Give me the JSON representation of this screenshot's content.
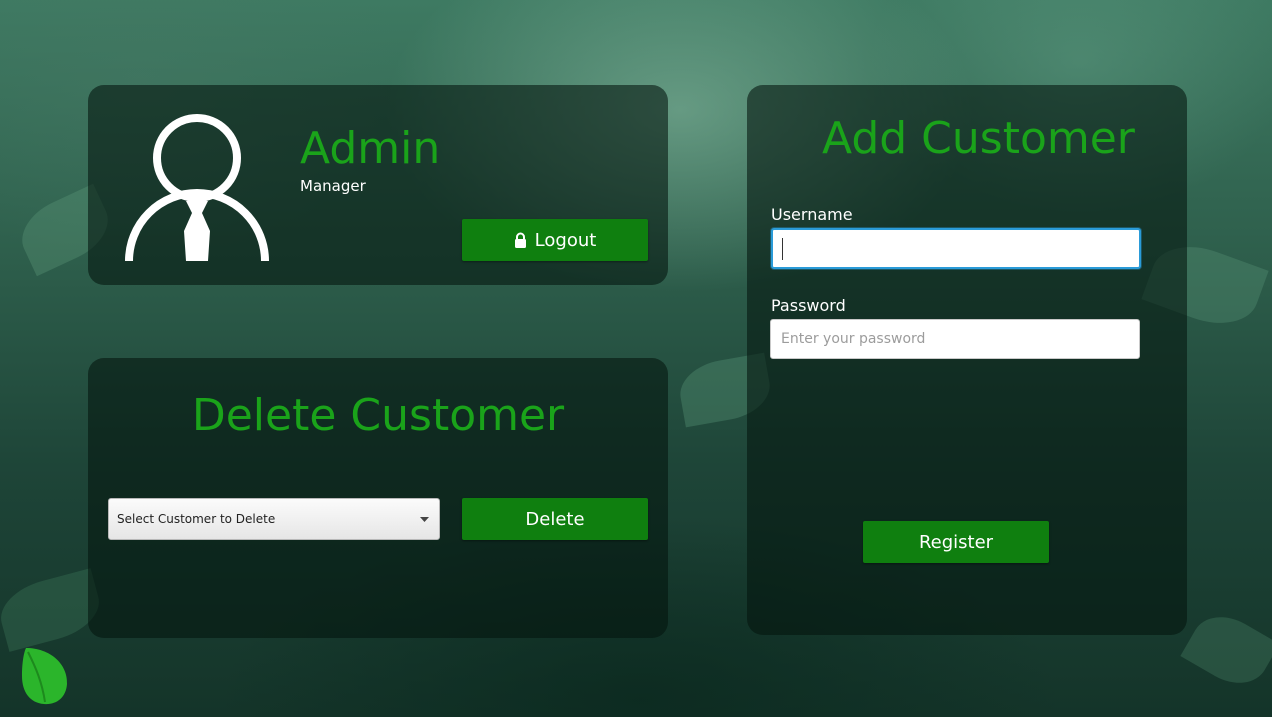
{
  "admin": {
    "name": "Admin",
    "role": "Manager",
    "logout_label": "Logout",
    "avatar_icon": "user-suit-icon",
    "lock_icon": "lock-icon"
  },
  "delete_customer": {
    "title": "Delete Customer",
    "select_value": "Select Customer to Delete",
    "delete_label": "Delete"
  },
  "add_customer": {
    "title": "Add Customer",
    "username_label": "Username",
    "username_value": "",
    "password_label": "Password",
    "password_placeholder": "Enter your password",
    "register_label": "Register"
  },
  "colors": {
    "accent": "#1aa31a",
    "button": "#0f7f0f"
  },
  "logo_icon": "leaf-icon"
}
